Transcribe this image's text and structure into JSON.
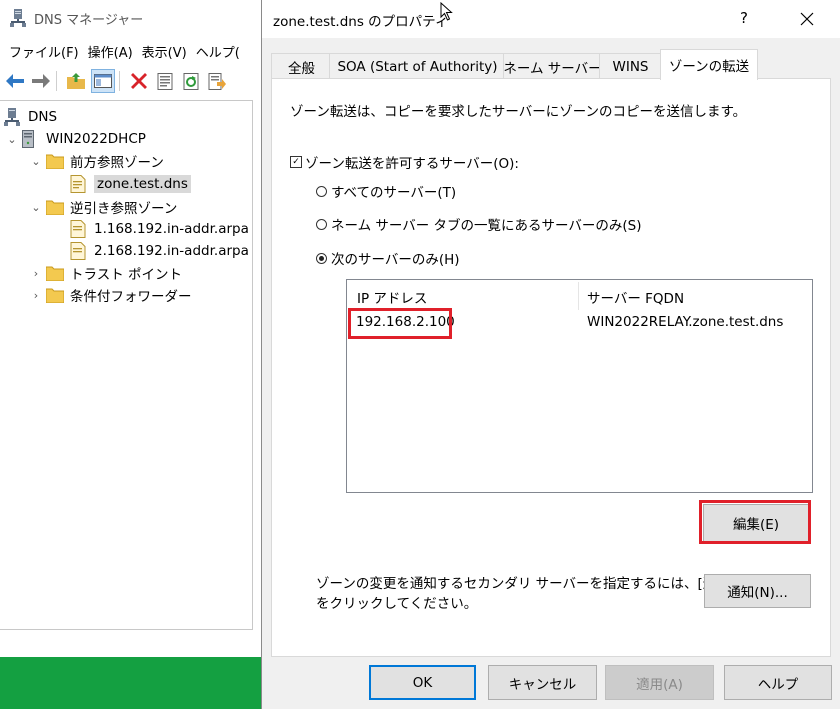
{
  "background_window": {
    "title": "DNS マネージャー",
    "menu": [
      "ファイル(F)",
      "操作(A)",
      "表示(V)",
      "ヘルプ("
    ],
    "tree": {
      "root": "DNS",
      "server": "WIN2022DHCP",
      "forward_zones": "前方参照ゾーン",
      "selected_zone": "zone.test.dns",
      "reverse_zones": "逆引き参照ゾーン",
      "reverse_zone_1": "1.168.192.in-addr.arpa",
      "reverse_zone_2": "2.168.192.in-addr.arpa",
      "trust_points": "トラスト ポイント",
      "conditional_forwarders": "条件付フォワーダー"
    }
  },
  "dialog": {
    "title": "zone.test.dns のプロパティ",
    "help": "?",
    "tabs": [
      "全般",
      "SOA (Start of Authority)",
      "ネーム サーバー",
      "WINS",
      "ゾーンの転送"
    ],
    "active_tab": "ゾーンの転送",
    "description": "ゾーン転送は、コピーを要求したサーバーにゾーンのコピーを送信します。",
    "allow_transfers_label": "ゾーン転送を許可するサーバー(O):",
    "allow_transfers_checked": true,
    "radio_options": [
      "すべてのサーバー(T)",
      "ネーム サーバー タブの一覧にあるサーバーのみ(S)",
      "次のサーバーのみ(H)"
    ],
    "selected_radio": "次のサーバーのみ(H)",
    "server_list": {
      "columns": [
        "IP アドレス",
        "サーバー FQDN"
      ],
      "rows": [
        {
          "ip": "192.168.2.100",
          "fqdn": "WIN2022RELAY.zone.test.dns"
        }
      ]
    },
    "edit_button": "編集(E)",
    "notify_text_line1": "ゾーンの変更を通知するセカンダリ サーバーを指定するには、[通知]",
    "notify_text_line2": "をクリックしてください。",
    "notify_button": "通知(N)...",
    "footer_buttons": {
      "ok": "OK",
      "cancel": "キャンセル",
      "apply": "適用(A)",
      "help": "ヘルプ"
    }
  },
  "colors": {
    "highlight_red": "#e0202a",
    "taskbar_green": "#14a041",
    "default_button_border": "#0078d7"
  }
}
